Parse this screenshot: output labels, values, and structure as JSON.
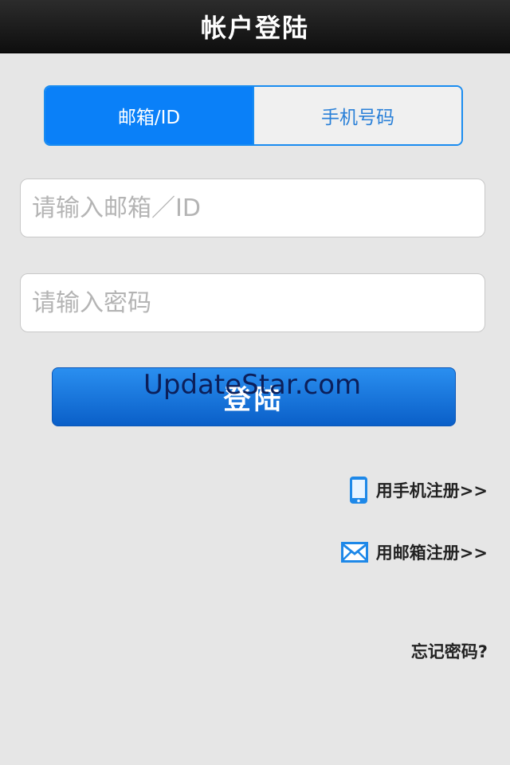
{
  "header": {
    "title": "帐户登陆"
  },
  "tabs": [
    {
      "label": "邮箱/ID",
      "active": true
    },
    {
      "label": "手机号码",
      "active": false
    }
  ],
  "form": {
    "email_placeholder": "请输入邮箱／ID",
    "email_value": "",
    "password_placeholder": "请输入密码",
    "password_value": "",
    "login_label": "登陆"
  },
  "links": {
    "phone_register": "用手机注册>>",
    "email_register": "用邮箱注册>>",
    "forgot_password": "忘记密码?"
  },
  "watermark": "UpdateStar.com",
  "colors": {
    "accent": "#0a80f8",
    "background": "#e6e6e6",
    "titlebar": "#111111"
  },
  "icons": {
    "phone": "mobile-phone-icon",
    "email": "envelope-icon"
  }
}
